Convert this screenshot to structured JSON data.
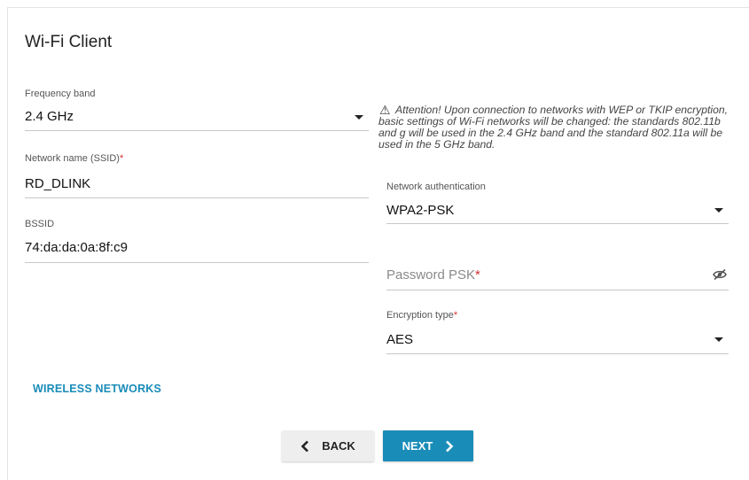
{
  "page_title": "Wi-Fi Client",
  "frequency_band": {
    "label": "Frequency band",
    "value": "2.4 GHz"
  },
  "network_name": {
    "label": "Network name (SSID)",
    "required_mark": "*",
    "value": "RD_DLINK"
  },
  "bssid": {
    "label": "BSSID",
    "value": "74:da:da:0a:8f:c9"
  },
  "attention_text": "Attention! Upon connection to networks with WEP or TKIP encryption, basic settings of Wi-Fi networks will be changed: the standards 802.11b and g will be used in the 2.4 GHz band and the standard 802.11a will be used in the 5 GHz band.",
  "network_authentication": {
    "label": "Network authentication",
    "value": "WPA2-PSK"
  },
  "password_psk": {
    "placeholder": "Password PSK",
    "required_mark": "*"
  },
  "encryption_type": {
    "label": "Encryption type",
    "required_mark": "*",
    "value": "AES"
  },
  "wireless_networks_link": "WIRELESS NETWORKS",
  "buttons": {
    "back": "BACK",
    "next": "NEXT"
  },
  "colors": {
    "accent": "#1a8cb8",
    "required": "#d32f2f",
    "back_button_bg": "#eeeeee"
  },
  "icons": {
    "warning": "warning-triangle-icon",
    "password_visibility": "eye-off-icon",
    "dropdown": "caret-down-icon"
  }
}
